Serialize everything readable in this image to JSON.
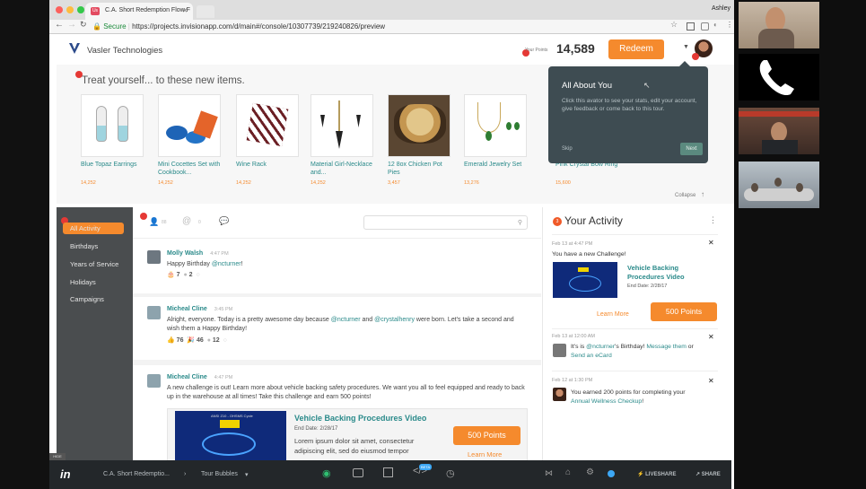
{
  "browser": {
    "tab_title": "C.A. Short Redemption Flow F",
    "tab_icon": "Us",
    "secure_label": "Secure",
    "url": "https://projects.invisionapp.com/d/main#/console/10307739/219240826/preview",
    "profile_name": "Ashley"
  },
  "header": {
    "company": "Vasler Technologies",
    "points_label": "Your Points",
    "points_value": "14,589",
    "redeem_label": "Redeem"
  },
  "treats": {
    "title": "Treat yourself... to these new items.",
    "items": [
      {
        "name": "Blue Topaz Earrings",
        "points": "14,252"
      },
      {
        "name": "Mini Cocettes Set with Cookbook...",
        "points": "14,252"
      },
      {
        "name": "Wine Rack",
        "points": "14,252"
      },
      {
        "name": "Material Girl-Necklace and...",
        "points": "14,252"
      },
      {
        "name": "12 8ox Chicken Pot Pies",
        "points": "3,457"
      },
      {
        "name": "Emerald Jewelry Set",
        "points": "13,276"
      },
      {
        "name": "Pink Crystal Bow Ring",
        "points": "15,600"
      }
    ],
    "collapse_label": "Collapse"
  },
  "tooltip": {
    "title": "All About You",
    "body": "Click this avator to see your stats, edit your account, give feedback or come back to this tour.",
    "skip": "Skip",
    "next": "Next"
  },
  "sidebar": {
    "items": [
      "All Activity",
      "Birthdays",
      "Years of Service",
      "Holidays",
      "Campaigns"
    ]
  },
  "feed": {
    "filters": [
      "88",
      "0",
      ""
    ],
    "posts": [
      {
        "author": "Molly Walsh",
        "time": "4:47 PM",
        "text_a": "Happy Birthday ",
        "mention_a": "@ncturner",
        "text_b": "!",
        "r1": "7",
        "r2": "2"
      },
      {
        "author": "Micheal Cline",
        "time": "3:45 PM",
        "text_a": "Alright, everyone. Today is a pretty awesome day because ",
        "mention_a": "@ncturner",
        "text_b": " and ",
        "mention_b": "@crystalhenry",
        "text_c": " were born. Let's take a second and wish them a Happy Birthday!",
        "r1": "76",
        "r2": "46",
        "r3": "12"
      },
      {
        "author": "Micheal Cline",
        "time": "4:47 PM",
        "text_a": "A new challenge is out! Learn more about vehicle backing safety procedures. We want you all to feel equipped and ready to back up in the warehouse at all times! Take this challenge and earn 500 points!"
      }
    ],
    "challenge": {
      "title": "Vehicle Backing Procedures Video",
      "end_date": "End Date: 2/28/17",
      "desc": "Lorem ipsum dolor sit amet, consectetur adipiscing elit, sed do eiusmod tempor",
      "points_btn": "500 Points",
      "learn_more": "Learn More",
      "thumb_caption": "ANSI Z10 - OHSMS Cycle"
    }
  },
  "activity": {
    "count": "3",
    "title": "Your Activity",
    "cards": [
      {
        "date": "Feb 13 at 4:47 PM",
        "text": "You have a new Challenge!",
        "title": "Vehicle Backing Procedures Video",
        "end": "End Date: 2/28/17",
        "learn": "Learn More",
        "points": "500 Points"
      },
      {
        "date": "Feb 13 at 12:00 AM",
        "pre": "It's is ",
        "mention": "@ncturner",
        "mid": "'s Birthday! ",
        "link1": "Message them",
        "or": " or",
        "link2": "Send an eCard"
      },
      {
        "date": "Feb 12 at 1:30 PM",
        "pre": "You earned 200 points for completing your ",
        "link1": "Annual Wellness Checkup",
        "post": "!"
      }
    ]
  },
  "taskbar": {
    "crumb1": "C.A. Short Redemptio...",
    "crumb2": "Tour Bubbles",
    "hide": "HIDE",
    "beta": "BETA",
    "liveshare": "LIVESHARE",
    "share": "SHARE"
  },
  "colors": {
    "accent": "#f58a2d",
    "teal": "#2a8a8a",
    "sidebar": "#4a4d4f",
    "tooltip": "#3e4c52"
  }
}
